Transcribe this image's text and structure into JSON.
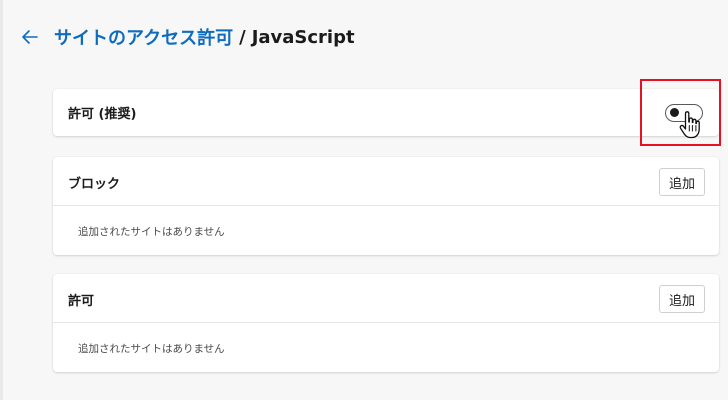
{
  "header": {
    "back_icon": "arrow-left-icon",
    "breadcrumb_parent": "サイトのアクセス許可",
    "breadcrumb_separator": "/",
    "breadcrumb_current": "JavaScript"
  },
  "allow_recommended": {
    "label": "許可 (推奨)",
    "toggle_state": "off"
  },
  "block_section": {
    "title": "ブロック",
    "add_label": "追加",
    "empty_text": "追加されたサイトはありません"
  },
  "allow_section": {
    "title": "許可",
    "add_label": "追加",
    "empty_text": "追加されたサイトはありません"
  },
  "colors": {
    "accent": "#0f6cbd",
    "highlight": "#e81123",
    "background": "#f7f7f7"
  }
}
